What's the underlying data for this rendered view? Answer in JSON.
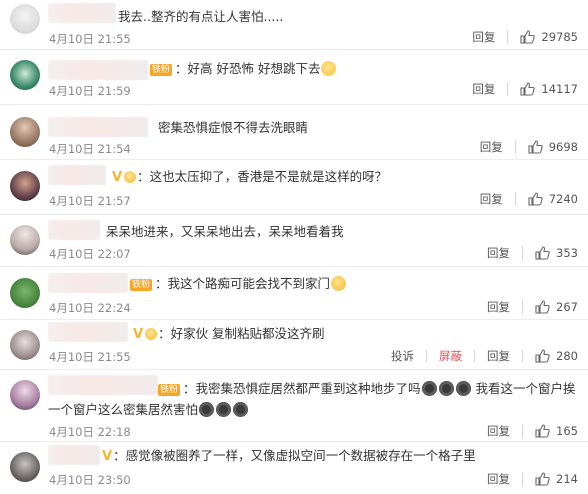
{
  "comments": [
    {
      "text": "我去..整齐的有点让人害怕.....",
      "time": "4月10日 21:55",
      "reply": "回复",
      "likes": "29785"
    },
    {
      "text": "：好高 好恐怖 好想跳下去",
      "badge": "铁粉",
      "time": "4月10日 21:59",
      "reply": "回复",
      "likes": "14117"
    },
    {
      "text": "密集恐惧症恨不得去洗眼睛",
      "time": "4月10日 21:54",
      "reply": "回复",
      "likes": "9698"
    },
    {
      "text": "：这也太压抑了，香港是不是就是这样的呀？",
      "time": "4月10日 21:57",
      "reply": "回复",
      "likes": "7240"
    },
    {
      "text": "呆呆地进来，又呆呆地出去，呆呆地看着我",
      "time": "4月10日 22:07",
      "reply": "回复",
      "likes": "353"
    },
    {
      "text": "：我这个路痴可能会找不到家门",
      "badge": "铁粉",
      "time": "4月10日 22:24",
      "reply": "回复",
      "likes": "267"
    },
    {
      "text": "：好家伙 复制粘贴都没这齐刷",
      "time": "4月10日 21:55",
      "report": "投诉",
      "block": "屏蔽",
      "reply": "回复",
      "likes": "280"
    },
    {
      "text_part1": "：我密集恐惧症居然都严重到这种地步了吗",
      "text_part2": "我看这一个窗户挨一个窗户这么密集居然害怕",
      "badge": "铁粉",
      "time": "4月10日 22:18",
      "reply": "回复",
      "likes": "165"
    },
    {
      "text": "：感觉像被圈养了一样，又像虚拟空间一个数据被存在一个格子里",
      "time": "4月10日 23:50",
      "reply": "回复",
      "likes": "214"
    }
  ],
  "colors": {
    "accent_red": "#e94e57",
    "badge": "#f7a623",
    "time_gray": "#8a8a8a"
  },
  "icons": {
    "like": "thumbs-up-icon"
  }
}
